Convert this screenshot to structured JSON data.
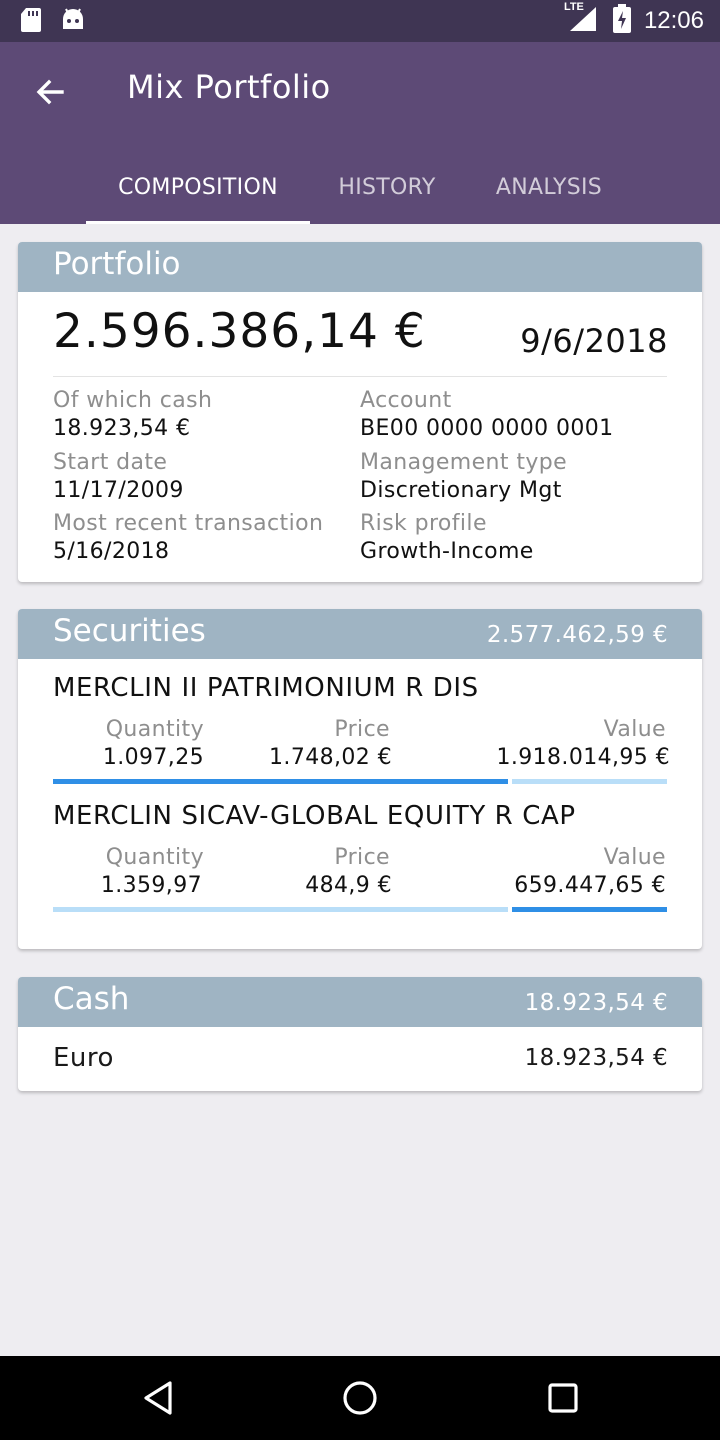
{
  "status_bar": {
    "time": "12:06",
    "network": "LTE",
    "icons": [
      "sd-card-icon",
      "android-icon",
      "signal-icon",
      "battery-charging-icon"
    ]
  },
  "app_bar": {
    "title": "Mix Portfolio",
    "back_icon": "arrow-back-icon",
    "tabs": [
      {
        "label": "COMPOSITION",
        "active": true
      },
      {
        "label": "HISTORY",
        "active": false
      },
      {
        "label": "ANALYSIS",
        "active": false
      }
    ]
  },
  "portfolio": {
    "header": "Portfolio",
    "total_value": "2.596.386,14 €",
    "date": "9/6/2018",
    "details": [
      {
        "label": "Of which cash",
        "value": "18.923,54 €"
      },
      {
        "label": "Account",
        "value": "BE00 0000 0000 0001"
      },
      {
        "label": "Start date",
        "value": "11/17/2009"
      },
      {
        "label": "Management type",
        "value": "Discretionary Mgt"
      },
      {
        "label": "Most recent transaction",
        "value": "5/16/2018"
      },
      {
        "label": "Risk profile",
        "value": "Growth-Income"
      }
    ]
  },
  "securities": {
    "header": "Securities",
    "total": "2.577.462,59 €",
    "columns": {
      "quantity": "Quantity",
      "price": "Price",
      "value": "Value"
    },
    "items": [
      {
        "name": "MERCLIN II PATRIMONIUM R DIS",
        "quantity": "1.097,25",
        "price": "1.748,02 €",
        "value": "1.918.014,95 €",
        "share": 0.744
      },
      {
        "name": "MERCLIN SICAV-GLOBAL EQUITY R CAP",
        "quantity": "1.359,97",
        "price": "484,9 €",
        "value": "659.447,65 €",
        "share": 0.256
      }
    ]
  },
  "cash": {
    "header": "Cash",
    "total": "18.923,54 €",
    "items": [
      {
        "name": "Euro",
        "value": "18.923,54 €"
      }
    ]
  },
  "colors": {
    "status_bar": "#3f3553",
    "app_bar": "#5d4a76",
    "card_header": "#9fb4c3",
    "bar_primary": "#2f8fe6",
    "bar_secondary": "#b9def8"
  },
  "nav_bar": {
    "icons": [
      "back-triangle-icon",
      "home-circle-icon",
      "recents-square-icon"
    ]
  }
}
